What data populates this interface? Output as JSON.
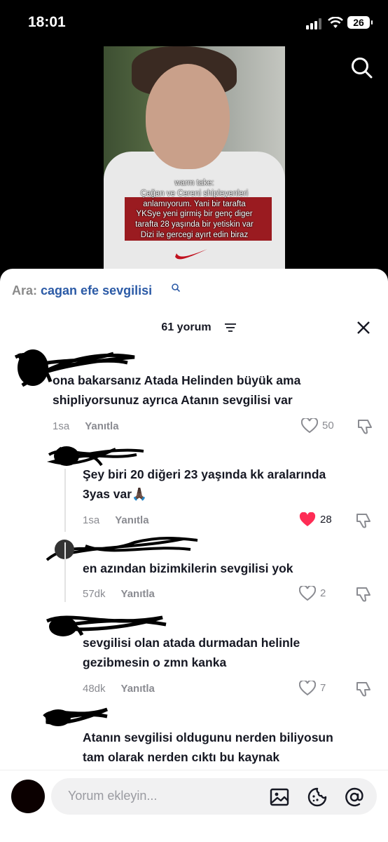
{
  "status_bar": {
    "time": "18:01",
    "battery": "26"
  },
  "video": {
    "caption_lines": [
      "warm take:",
      "Çağan ve Cereni shipleyenleri",
      "anlamıyorum. Yani bir tarafta",
      "YKSye yeni girmiş bir genç diger",
      "tarafta 28 yaşında bir yetiskin var",
      "Dizi ile gercegi ayırt edin biraz"
    ]
  },
  "search": {
    "prefix": "Ara:",
    "query": "cagan efe sevgilisi"
  },
  "comments_header": {
    "count_label": "61 yorum"
  },
  "comments": [
    {
      "text_lines": [
        "ona bakarsanız Atada Helinden büyük ama",
        "shipliyorsunuz ayrıca Atanın sevgilisi var"
      ],
      "time": "1sa",
      "reply": "Yanıtla",
      "likes": "50",
      "liked": false
    },
    {
      "text_lines": [
        "Şey biri 20 diğeri 23 yaşında kk aralarında",
        "3yas var🙏🏿"
      ],
      "time": "1sa",
      "reply": "Yanıtla",
      "likes": "28",
      "liked": true
    },
    {
      "text_lines": [
        "en azından bizimkilerin sevgilisi yok"
      ],
      "time": "57dk",
      "reply": "Yanıtla",
      "likes": "2",
      "liked": false
    },
    {
      "text_lines": [
        "sevgilisi olan atada durmadan helinle",
        "gezibmesin o zmn kanka"
      ],
      "time": "48dk",
      "reply": "Yanıtla",
      "likes": "7",
      "liked": false
    },
    {
      "text_lines": [
        "Atanın sevgilisi oldugunu nerden biliyosun",
        "tam olarak nerden cıktı bu kaynak"
      ]
    }
  ],
  "composer": {
    "placeholder": "Yorum ekleyin..."
  },
  "colors": {
    "link_blue": "#2b5aa6",
    "like_red": "#fe2c55",
    "muted": "#8a8b91"
  }
}
